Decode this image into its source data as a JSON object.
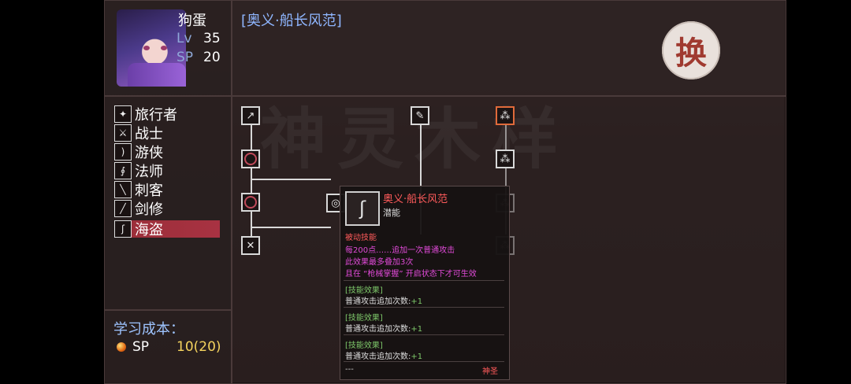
{
  "player": {
    "name": "狗蛋",
    "lv_label": "Lv",
    "lv": "35",
    "sp_label": "SP",
    "sp": "20"
  },
  "skill_header": "[奥义·船长风范]",
  "switch_button": {
    "label": "换"
  },
  "classes": [
    {
      "label": "旅行者",
      "icon": "traveler-icon",
      "active": false
    },
    {
      "label": "战士",
      "icon": "warrior-icon",
      "active": false
    },
    {
      "label": "游侠",
      "icon": "bow-icon",
      "active": false
    },
    {
      "label": "法师",
      "icon": "staff-icon",
      "active": false
    },
    {
      "label": "刺客",
      "icon": "dagger-icon",
      "active": false
    },
    {
      "label": "剑修",
      "icon": "sword-icon",
      "active": false
    },
    {
      "label": "海盗",
      "icon": "hook-icon",
      "active": true
    }
  ],
  "cost": {
    "title": "学习成本：",
    "sp_label": "SP",
    "sp_value": "10(20)"
  },
  "tooltip": {
    "name": "奥义·船长风范",
    "sub": "潜能",
    "type": "被动技能",
    "desc": [
      "每200点……追加一次普通攻击",
      "此效果最多叠加3次",
      "且在 “枪械掌握” 开启状态下才可生效"
    ],
    "effects": [
      {
        "title": "[技能效果]",
        "text": "普通攻击追加次数:",
        "value": "+1"
      },
      {
        "title": "[技能效果]",
        "text": "普通攻击追加次数:",
        "value": "+1"
      },
      {
        "title": "[技能效果]",
        "text": "普通攻击追加次数:",
        "value": "+1"
      }
    ],
    "footer_left": "---",
    "footer_right": "神圣"
  },
  "colors": {
    "accent": "#a83242",
    "title_blue": "#8fb6ff",
    "tooltip_red": "#ff5b5b",
    "desc_magenta": "#e04ad8",
    "effect_green": "#7ec86a"
  }
}
